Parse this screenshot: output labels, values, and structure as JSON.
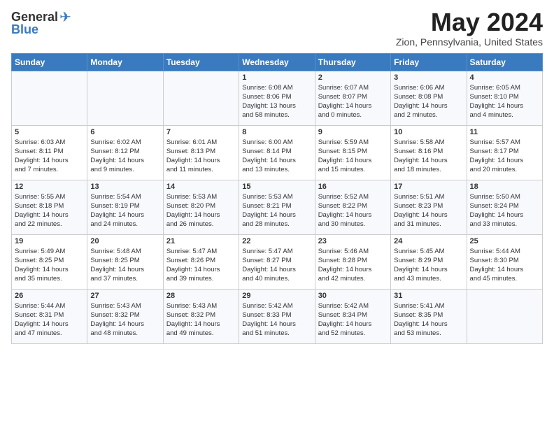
{
  "logo": {
    "general": "General",
    "blue": "Blue"
  },
  "title": "May 2024",
  "location": "Zion, Pennsylvania, United States",
  "days_header": [
    "Sunday",
    "Monday",
    "Tuesday",
    "Wednesday",
    "Thursday",
    "Friday",
    "Saturday"
  ],
  "weeks": [
    [
      {
        "day": "",
        "content": ""
      },
      {
        "day": "",
        "content": ""
      },
      {
        "day": "",
        "content": ""
      },
      {
        "day": "1",
        "content": "Sunrise: 6:08 AM\nSunset: 8:06 PM\nDaylight: 13 hours\nand 58 minutes."
      },
      {
        "day": "2",
        "content": "Sunrise: 6:07 AM\nSunset: 8:07 PM\nDaylight: 14 hours\nand 0 minutes."
      },
      {
        "day": "3",
        "content": "Sunrise: 6:06 AM\nSunset: 8:08 PM\nDaylight: 14 hours\nand 2 minutes."
      },
      {
        "day": "4",
        "content": "Sunrise: 6:05 AM\nSunset: 8:10 PM\nDaylight: 14 hours\nand 4 minutes."
      }
    ],
    [
      {
        "day": "5",
        "content": "Sunrise: 6:03 AM\nSunset: 8:11 PM\nDaylight: 14 hours\nand 7 minutes."
      },
      {
        "day": "6",
        "content": "Sunrise: 6:02 AM\nSunset: 8:12 PM\nDaylight: 14 hours\nand 9 minutes."
      },
      {
        "day": "7",
        "content": "Sunrise: 6:01 AM\nSunset: 8:13 PM\nDaylight: 14 hours\nand 11 minutes."
      },
      {
        "day": "8",
        "content": "Sunrise: 6:00 AM\nSunset: 8:14 PM\nDaylight: 14 hours\nand 13 minutes."
      },
      {
        "day": "9",
        "content": "Sunrise: 5:59 AM\nSunset: 8:15 PM\nDaylight: 14 hours\nand 15 minutes."
      },
      {
        "day": "10",
        "content": "Sunrise: 5:58 AM\nSunset: 8:16 PM\nDaylight: 14 hours\nand 18 minutes."
      },
      {
        "day": "11",
        "content": "Sunrise: 5:57 AM\nSunset: 8:17 PM\nDaylight: 14 hours\nand 20 minutes."
      }
    ],
    [
      {
        "day": "12",
        "content": "Sunrise: 5:55 AM\nSunset: 8:18 PM\nDaylight: 14 hours\nand 22 minutes."
      },
      {
        "day": "13",
        "content": "Sunrise: 5:54 AM\nSunset: 8:19 PM\nDaylight: 14 hours\nand 24 minutes."
      },
      {
        "day": "14",
        "content": "Sunrise: 5:53 AM\nSunset: 8:20 PM\nDaylight: 14 hours\nand 26 minutes."
      },
      {
        "day": "15",
        "content": "Sunrise: 5:53 AM\nSunset: 8:21 PM\nDaylight: 14 hours\nand 28 minutes."
      },
      {
        "day": "16",
        "content": "Sunrise: 5:52 AM\nSunset: 8:22 PM\nDaylight: 14 hours\nand 30 minutes."
      },
      {
        "day": "17",
        "content": "Sunrise: 5:51 AM\nSunset: 8:23 PM\nDaylight: 14 hours\nand 31 minutes."
      },
      {
        "day": "18",
        "content": "Sunrise: 5:50 AM\nSunset: 8:24 PM\nDaylight: 14 hours\nand 33 minutes."
      }
    ],
    [
      {
        "day": "19",
        "content": "Sunrise: 5:49 AM\nSunset: 8:25 PM\nDaylight: 14 hours\nand 35 minutes."
      },
      {
        "day": "20",
        "content": "Sunrise: 5:48 AM\nSunset: 8:25 PM\nDaylight: 14 hours\nand 37 minutes."
      },
      {
        "day": "21",
        "content": "Sunrise: 5:47 AM\nSunset: 8:26 PM\nDaylight: 14 hours\nand 39 minutes."
      },
      {
        "day": "22",
        "content": "Sunrise: 5:47 AM\nSunset: 8:27 PM\nDaylight: 14 hours\nand 40 minutes."
      },
      {
        "day": "23",
        "content": "Sunrise: 5:46 AM\nSunset: 8:28 PM\nDaylight: 14 hours\nand 42 minutes."
      },
      {
        "day": "24",
        "content": "Sunrise: 5:45 AM\nSunset: 8:29 PM\nDaylight: 14 hours\nand 43 minutes."
      },
      {
        "day": "25",
        "content": "Sunrise: 5:44 AM\nSunset: 8:30 PM\nDaylight: 14 hours\nand 45 minutes."
      }
    ],
    [
      {
        "day": "26",
        "content": "Sunrise: 5:44 AM\nSunset: 8:31 PM\nDaylight: 14 hours\nand 47 minutes."
      },
      {
        "day": "27",
        "content": "Sunrise: 5:43 AM\nSunset: 8:32 PM\nDaylight: 14 hours\nand 48 minutes."
      },
      {
        "day": "28",
        "content": "Sunrise: 5:43 AM\nSunset: 8:32 PM\nDaylight: 14 hours\nand 49 minutes."
      },
      {
        "day": "29",
        "content": "Sunrise: 5:42 AM\nSunset: 8:33 PM\nDaylight: 14 hours\nand 51 minutes."
      },
      {
        "day": "30",
        "content": "Sunrise: 5:42 AM\nSunset: 8:34 PM\nDaylight: 14 hours\nand 52 minutes."
      },
      {
        "day": "31",
        "content": "Sunrise: 5:41 AM\nSunset: 8:35 PM\nDaylight: 14 hours\nand 53 minutes."
      },
      {
        "day": "",
        "content": ""
      }
    ]
  ]
}
